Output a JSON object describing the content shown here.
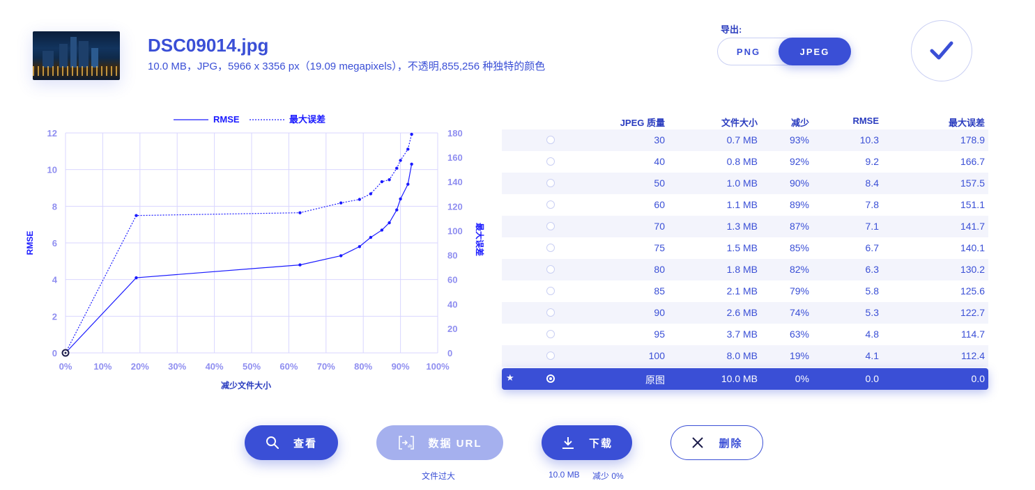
{
  "file": {
    "name": "DSC09014.jpg",
    "details": "10.0 MB，JPG，5966 x 3356 px（19.09 megapixels），不透明,855,256 种独特的颜色"
  },
  "export": {
    "label": "导出:",
    "options": [
      "PNG",
      "JPEG"
    ],
    "selected": "JPEG"
  },
  "confirm_icon": "checkmark-icon",
  "table": {
    "headers": {
      "quality": "JPEG 质量",
      "size": "文件大小",
      "reduction": "减少",
      "rmse": "RMSE",
      "max_error": "最大误差"
    },
    "rows": [
      {
        "quality": "30",
        "size": "0.7 MB",
        "reduction": "93%",
        "rmse": "10.3",
        "max_error": "178.9"
      },
      {
        "quality": "40",
        "size": "0.8 MB",
        "reduction": "92%",
        "rmse": "9.2",
        "max_error": "166.7"
      },
      {
        "quality": "50",
        "size": "1.0 MB",
        "reduction": "90%",
        "rmse": "8.4",
        "max_error": "157.5"
      },
      {
        "quality": "60",
        "size": "1.1 MB",
        "reduction": "89%",
        "rmse": "7.8",
        "max_error": "151.1"
      },
      {
        "quality": "70",
        "size": "1.3 MB",
        "reduction": "87%",
        "rmse": "7.1",
        "max_error": "141.7"
      },
      {
        "quality": "75",
        "size": "1.5 MB",
        "reduction": "85%",
        "rmse": "6.7",
        "max_error": "140.1"
      },
      {
        "quality": "80",
        "size": "1.8 MB",
        "reduction": "82%",
        "rmse": "6.3",
        "max_error": "130.2"
      },
      {
        "quality": "85",
        "size": "2.1 MB",
        "reduction": "79%",
        "rmse": "5.8",
        "max_error": "125.6"
      },
      {
        "quality": "90",
        "size": "2.6 MB",
        "reduction": "74%",
        "rmse": "5.3",
        "max_error": "122.7"
      },
      {
        "quality": "95",
        "size": "3.7 MB",
        "reduction": "63%",
        "rmse": "4.8",
        "max_error": "114.7"
      },
      {
        "quality": "100",
        "size": "8.0 MB",
        "reduction": "19%",
        "rmse": "4.1",
        "max_error": "112.4"
      },
      {
        "quality": "原图",
        "size": "10.0 MB",
        "reduction": "0%",
        "rmse": "0.0",
        "max_error": "0.0",
        "selected": true,
        "marker": "★"
      }
    ]
  },
  "chart_data": {
    "type": "line",
    "xlabel": "减少文件大小",
    "ylabel": "RMSE",
    "y2label": "最大误差",
    "x_ticks": [
      "0%",
      "10%",
      "20%",
      "30%",
      "40%",
      "50%",
      "60%",
      "70%",
      "80%",
      "90%",
      "100%"
    ],
    "y_ticks": [
      "0",
      "2",
      "4",
      "6",
      "8",
      "10",
      "12"
    ],
    "y2_ticks": [
      "0",
      "20",
      "40",
      "60",
      "80",
      "100",
      "120",
      "140",
      "160",
      "180"
    ],
    "xlim": [
      0,
      100
    ],
    "ylim": [
      0,
      12
    ],
    "y2lim": [
      0,
      180
    ],
    "grid": true,
    "legend": "top-center",
    "series": [
      {
        "name": "RMSE",
        "axis": "left",
        "style": "solid",
        "x": [
          0,
          19,
          63,
          74,
          79,
          82,
          85,
          87,
          89,
          90,
          92,
          93
        ],
        "y": [
          0.0,
          4.1,
          4.8,
          5.3,
          5.8,
          6.3,
          6.7,
          7.1,
          7.8,
          8.4,
          9.2,
          10.3
        ]
      },
      {
        "name": "最大误差",
        "axis": "right",
        "style": "dotted",
        "x": [
          0,
          19,
          63,
          74,
          79,
          82,
          85,
          87,
          89,
          90,
          92,
          93
        ],
        "y": [
          0.0,
          112.4,
          114.7,
          122.7,
          125.6,
          130.2,
          140.1,
          141.7,
          151.1,
          157.5,
          166.7,
          178.9
        ]
      }
    ],
    "color": "#1a1aff",
    "grid_color": "#d9d6ff",
    "tick_color": "#8f8ef0"
  },
  "buttons": {
    "view": "查看",
    "data_url": "数据 URL",
    "download": "下载",
    "delete": "删除"
  },
  "notes": {
    "data_url": "文件过大",
    "download_size": "10.0 MB",
    "download_reduction": "减少 0%"
  }
}
